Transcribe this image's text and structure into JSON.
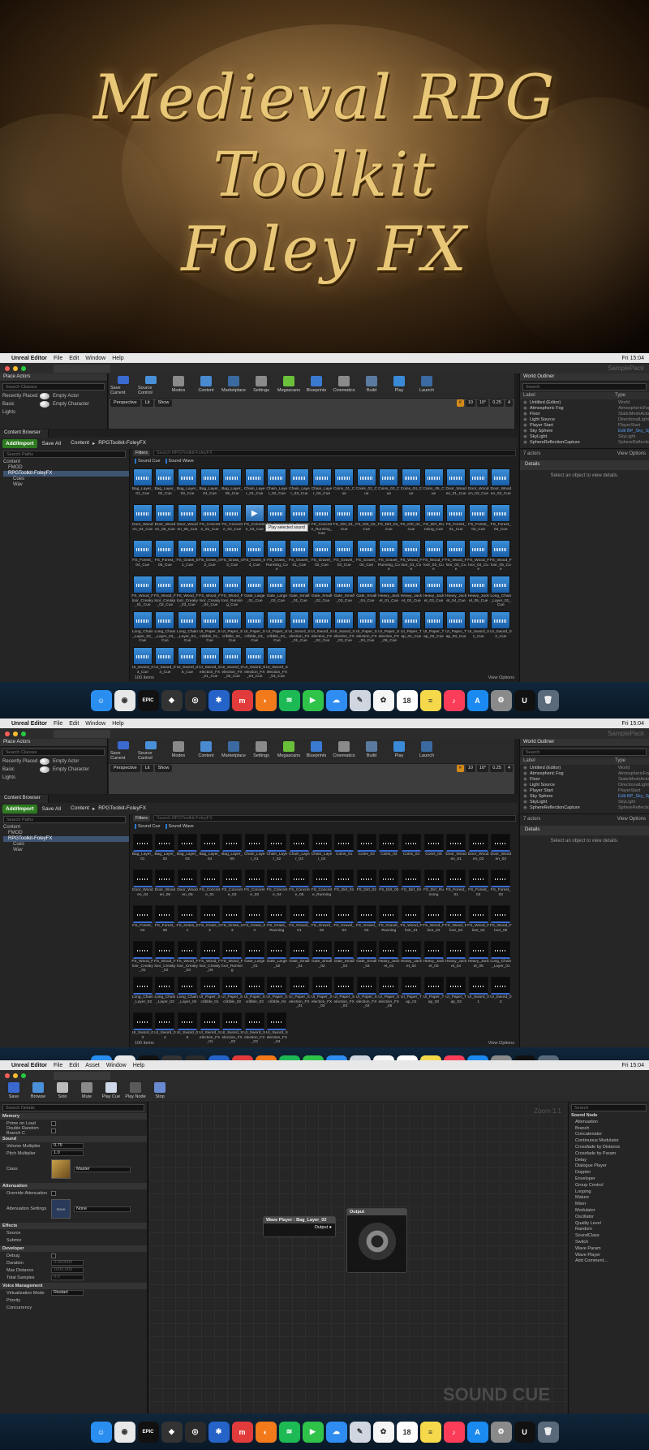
{
  "hero": {
    "line1": "Medieval RPG",
    "line2": "Toolkit",
    "line3": "Foley FX"
  },
  "menubar": {
    "app": "Unreal Editor",
    "items": [
      "File",
      "Edit",
      "Window",
      "Help"
    ],
    "time": "Fri 15:04"
  },
  "sc_menubar": {
    "app": "Unreal Editor",
    "items": [
      "File",
      "Edit",
      "Asset",
      "Window",
      "Help"
    ],
    "time": "Fri 15:04"
  },
  "project_name": "SamplePack",
  "place_actors": {
    "title": "Place Actors",
    "search_placeholder": "Search Classes",
    "categories": [
      "Recently Placed",
      "Basic",
      "Lights"
    ],
    "actors": [
      "Empty Actor",
      "Empty Character"
    ]
  },
  "toolbar": [
    "Save Current",
    "Source Control",
    "Modes",
    "Content",
    "Marketplace",
    "Settings",
    "Megascans",
    "Blueprints",
    "Cinematics",
    "Build",
    "Play",
    "Launch"
  ],
  "viewport": {
    "perspective": "Perspective",
    "lit": "Lit",
    "show": "Show",
    "snap1": "10",
    "snap2": "10°",
    "snap3": "0.25",
    "cam": "4"
  },
  "outliner": {
    "title": "World Outliner",
    "search_placeholder": "Search",
    "col_label": "Label",
    "col_type": "Type",
    "rows": [
      {
        "label": "Untitled (Editor)",
        "type": "World"
      },
      {
        "label": "Atmospheric Fog",
        "type": "AtmosphericFog"
      },
      {
        "label": "Floor",
        "type": "StaticMeshActor"
      },
      {
        "label": "Light Source",
        "type": "DirectionalLight"
      },
      {
        "label": "Player Start",
        "type": "PlayerStart"
      },
      {
        "label": "Sky Sphere",
        "type": "Edit BP_Sky_Sph"
      },
      {
        "label": "SkyLight",
        "type": "SkyLight"
      },
      {
        "label": "SphereReflectionCapture",
        "type": "SphereReflectionC"
      }
    ],
    "count": "7 actors",
    "view_options": "View Options",
    "details_title": "Details",
    "details_empty": "Select an object to view details."
  },
  "content_browser": {
    "tab": "Content Browser",
    "add_import": "Add/Import",
    "save_all": "Save All",
    "crumb_root": "Content",
    "crumb_folder": "RPGToolkit-FoleyFX",
    "search_paths": "Search Paths",
    "tree": [
      "Content",
      "FMOD",
      "RPGToolkit-FoleyFX",
      "Cues",
      "Wav"
    ],
    "filters": "Filters",
    "search_assets": "Search RPGToolkit-FoleyFX",
    "type_chips": [
      "Sound Cue",
      "Sound Wave"
    ],
    "tooltip": "Play selected sound",
    "item_count": "100 items",
    "view_options": "View Options"
  },
  "cues": [
    "Bag_Layer_01_Cue",
    "Bag_Layer_02_Cue",
    "Bag_Layer_03_Cue",
    "Bag_Layer_04_Cue",
    "Bag_Layer_05_Cue",
    "Chain_Layer_01_Cue",
    "Chain_Layer_02_Cue",
    "Chain_Layer_03_Cue",
    "Chain_Layer_04_Cue",
    "Coins_01_Cue",
    "Coins_02_Cue",
    "Coins_03_Cue",
    "Coins_04_Cue",
    "Coins_05_Cue",
    "Door_Wooden_01_Cue",
    "Door_Wooden_02_Cue",
    "Door_Wooden_03_Cue",
    "Door_Wooden_04_Cue",
    "Door_Wooden_05_Cue",
    "Door_Wooden_06_Cue",
    "FS_Concrete_01_Cue",
    "FS_Concrete_02_Cue",
    "FS_Concrete_03_Cue",
    "FS_Concrete_04_Cue",
    "FS_Concrete_05_Cue",
    "FS_Concrete_Running_Cue",
    "FS_Dirt_01_Cue",
    "FS_Dirt_02_Cue",
    "FS_Dirt_03_Cue",
    "FS_Dirt_04_Cue",
    "FS_Dirt_Running_Cue",
    "FS_Forest_01_Cue",
    "FS_Forest_02_Cue",
    "FS_Forest_03_Cue",
    "FS_Forest_04_Cue",
    "FS_Forest_05_Cue",
    "FS_Grass_01_Cue",
    "FS_Grass_02_Cue",
    "FS_Grass_03_Cue",
    "FS_Grass_04_Cue",
    "FS_Grass_Running_Cue",
    "FS_Gravel_01_Cue",
    "FS_Gravel_02_Cue",
    "FS_Gravel_03_Cue",
    "FS_Gravel_04_Cue",
    "FS_Gravel_Running_Cue",
    "FS_Wood_Floor_01_Cue",
    "FS_Wood_Floor_02_Cue",
    "FS_Wood_Floor_03_Cue",
    "FS_Wood_Floor_04_Cue",
    "FS_Wood_Floor_05_Cue",
    "FS_Wood_Floor_Creaky_01_Cue",
    "FS_Wood_Floor_Creaky_02_Cue",
    "FS_Wood_Floor_Creaky_03_Cue",
    "FS_Wood_Floor_Creaky_04_Cue",
    "FS_Wood_Floor_Running_Cue",
    "Gate_Large_01_Cue",
    "Gate_Large_02_Cue",
    "Gate_Small_01_Cue",
    "Gate_Small_02_Cue",
    "Gate_Small_03_Cue",
    "Gate_Small_04_Cue",
    "Heavy_Jacket_01_Cue",
    "Heavy_Jacket_02_Cue",
    "Heavy_Jacket_03_Cue",
    "Heavy_Jacket_04_Cue",
    "Heavy_Jacket_05_Cue",
    "Long_Chain_Layer_01_Cue",
    "Long_Chain_Layer_02_Cue",
    "Long_Chain_Layer_03_Cue",
    "Long_Chain_Layer_04_Cue",
    "UI_Paper_Scribble_01_Cue",
    "UI_Paper_Scribble_02_Cue",
    "UI_Paper_Scribble_03_Cue",
    "UI_Paper_Scribble_04_Cue",
    "UI_Sword_Selection_FX_01_Cue",
    "UI_Sword_Selection_FX_02_Cue",
    "UI_Sword_Selection_FX_03_Cue",
    "UI_Paper_Selection_FX_04_Cue",
    "UI_Paper_Selection_FX_05_Cue",
    "UI_Paper_Tap_01_Cue",
    "UI_Paper_Tap_02_Cue",
    "UI_Paper_Tap_03_Cue",
    "UI_Sword_01_Cue",
    "UI_Sword_02_Cue",
    "UI_Sword_03_Cue",
    "UI_Sword_04_Cue",
    "UI_Sword_05_Cue",
    "UI_Sword_Selection_FX_01_Cue",
    "UI_Sword_Selection_FX_02_Cue",
    "UI_Sword_Selection_FX_03_Cue",
    "UI_Sword_Selection_FX_04_Cue"
  ],
  "waves": [
    "Bag_Layer_01",
    "Bag_Layer_02",
    "Bag_Layer_03",
    "Bag_Layer_04",
    "Bag_Layer_05",
    "Chain_Layer_01",
    "Chain_Layer_02",
    "Chain_Layer_03",
    "Chain_Layer_04",
    "Coins_01",
    "Coins_02",
    "Coins_03",
    "Coins_04",
    "Coins_05",
    "Door_Wooden_01",
    "Door_Wooden_02",
    "Door_Wooden_03",
    "Door_Wooden_04",
    "Door_Wooden_05",
    "Door_Wooden_06",
    "FS_Concrete_01",
    "FS_Concrete_02",
    "FS_Concrete_03",
    "FS_Concrete_04",
    "FS_Concrete_05",
    "FS_Concrete_Running",
    "FS_Dirt_01",
    "FS_Dirt_02",
    "FS_Dirt_03",
    "FS_Dirt_04",
    "FS_Dirt_Running",
    "FS_Forest_01",
    "FS_Forest_02",
    "FS_Forest_03",
    "FS_Forest_04",
    "FS_Forest_05",
    "FS_Grass_01",
    "FS_Grass_02",
    "FS_Grass_03",
    "FS_Grass_04",
    "FS_Grass_Running",
    "FS_Gravel_01",
    "FS_Gravel_02",
    "FS_Gravel_03",
    "FS_Gravel_04",
    "FS_Gravel_Running",
    "FS_Wood_Floor_01",
    "FS_Wood_Floor_02",
    "FS_Wood_Floor_03",
    "FS_Wood_Floor_04",
    "FS_Wood_Floor_05",
    "FS_Wood_Floor_Creaky_01",
    "FS_Wood_Floor_Creaky_02",
    "FS_Wood_Floor_Creaky_03",
    "FS_Wood_Floor_Creaky_04",
    "FS_Wood_Floor_Running",
    "Gate_Large_01",
    "Gate_Large_02",
    "Gate_Small_01",
    "Gate_Small_02",
    "Gate_Small_03",
    "Gate_Small_04",
    "Heavy_Jacket_01",
    "Heavy_Jacket_02",
    "Heavy_Jacket_03",
    "Heavy_Jacket_04",
    "Heavy_Jacket_05",
    "Long_Chain_Layer_01",
    "Long_Chain_Layer_02",
    "Long_Chain_Layer_03",
    "Long_Chain_Layer_04",
    "UI_Paper_Scribble_01",
    "UI_Paper_Scribble_02",
    "UI_Paper_Scribble_03",
    "UI_Paper_Scribble_04",
    "UI_Paper_Selection_FX_01",
    "UI_Paper_Selection_FX_02",
    "UI_Paper_Selection_FX_03",
    "UI_Paper_Selection_FX_04",
    "UI_Paper_Selection_FX_05",
    "UI_Paper_Tap_01",
    "UI_Paper_Tap_02",
    "UI_Paper_Tap_03",
    "UI_Sword_01",
    "UI_Sword_02",
    "UI_Sword_03",
    "UI_Sword_04",
    "UI_Sword_05",
    "UI_Sword_Selection_FX_01",
    "UI_Sword_Selection_FX_02",
    "UI_Sword_Selection_FX_03",
    "UI_Sword_Selection_FX_04"
  ],
  "dock": [
    {
      "name": "finder-icon",
      "color": "#2a8ef0",
      "glyph": "☺"
    },
    {
      "name": "chrome-icon",
      "color": "#e8e8e8",
      "glyph": "◉"
    },
    {
      "name": "epic-games-icon",
      "color": "#111111",
      "glyph": "EPIC"
    },
    {
      "name": "unity-icon",
      "color": "#333333",
      "glyph": "◆"
    },
    {
      "name": "app-icon",
      "color": "#2b2b2b",
      "glyph": "◎"
    },
    {
      "name": "sourcetree-icon",
      "color": "#2563c9",
      "glyph": "✱"
    },
    {
      "name": "meister-icon",
      "color": "#e23b3b",
      "glyph": "m"
    },
    {
      "name": "blender-icon",
      "color": "#f27a1a",
      "glyph": "◐"
    },
    {
      "name": "spotify-icon",
      "color": "#1db954",
      "glyph": "≋"
    },
    {
      "name": "facetime-icon",
      "color": "#2fc34a",
      "glyph": "▶"
    },
    {
      "name": "messages-icon",
      "color": "#2f8cf0",
      "glyph": "☁"
    },
    {
      "name": "preview-icon",
      "color": "#cfd6e0",
      "glyph": "✎"
    },
    {
      "name": "photos-icon",
      "color": "#f5f5f5",
      "glyph": "✿"
    },
    {
      "name": "calendar-icon",
      "color": "#ffffff",
      "glyph": "18"
    },
    {
      "name": "notes-icon",
      "color": "#f5d94a",
      "glyph": "≡"
    },
    {
      "name": "music-icon",
      "color": "#fb3d5a",
      "glyph": "♪"
    },
    {
      "name": "app-store-icon",
      "color": "#1a8af0",
      "glyph": "A"
    },
    {
      "name": "system-preferences-icon",
      "color": "#8a8a8a",
      "glyph": "⚙"
    },
    {
      "name": "unreal-icon",
      "color": "#111111",
      "glyph": "U"
    },
    {
      "name": "trash-icon",
      "color": "#5a6a7a",
      "glyph": "🗑"
    }
  ],
  "sound_cue": {
    "toolbar": [
      "Save",
      "Browse",
      "Solo",
      "Mute",
      "Play Cue",
      "Play Node",
      "Stop"
    ],
    "search_details": "Search Details",
    "sections": {
      "memory": "Memory",
      "sound": "Sound",
      "attenuation": "Attenuation",
      "effects": "Effects",
      "developer": "Developer",
      "voice": "Voice Management"
    },
    "props": {
      "prime": "Prime on Load",
      "double_branch": "Double Random Branch C",
      "volume": "Volume Multiplier",
      "volume_val": "0.75",
      "pitch": "Pitch Multiplier",
      "pitch_val": "1.0",
      "class": "Class",
      "class_val": "Master",
      "override": "Override Attenuation",
      "att_settings": "Attenuation Settings",
      "att_val": "None",
      "none_thumb": "None",
      "source": "Source",
      "submix": "Submix",
      "debug": "Debug",
      "duration": "Duration",
      "duration_val": "3.000000",
      "max_distance": "Max Distance",
      "max_distance_val": "1000.000",
      "total_samples": "Total Samples",
      "total_samples_val": "0.0",
      "virt_mode": "Virtualization Mode",
      "virt_val": "Restart",
      "priority": "Priority",
      "concurrency": "Concurrency"
    },
    "node_wave": "Wave Player : Bag_Layer_02",
    "node_output_pin": "Output",
    "node_output": "Output",
    "zoom": "Zoom 1:1",
    "watermark": "SOUND CUE",
    "palette_search": "Search",
    "palette_header": "Sound Node",
    "palette": [
      "Attenuation",
      "Branch",
      "Concatenator",
      "Continuous Modulator",
      "Crossfade by Distance",
      "Crossfade by Param",
      "Delay",
      "Dialogue Player",
      "Doppler",
      "Enveloper",
      "Group Control",
      "Looping",
      "Mature",
      "Mixer",
      "Modulator",
      "Oscillator",
      "Quality Level",
      "Random",
      "SoundClass",
      "Switch",
      "Wave Param",
      "Wave Player",
      "Add Comment..."
    ]
  }
}
